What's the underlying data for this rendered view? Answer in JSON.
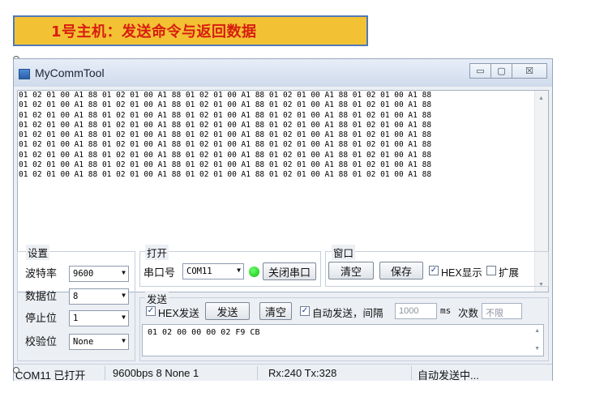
{
  "banner": {
    "text": "1号主机：发送命令与返回数据"
  },
  "window": {
    "title": "MyCommTool",
    "buttons": {
      "minimize": "▭",
      "maximize": "▢",
      "close": "☒"
    }
  },
  "receive": {
    "lines": [
      "01 02 01 00 A1 88 01 02 01 00 A1 88 01 02 01 00 A1 88 01 02 01 00 A1 88 01 02 01 00 A1 88",
      "01 02 01 00 A1 88 01 02 01 00 A1 88 01 02 01 00 A1 88 01 02 01 00 A1 88 01 02 01 00 A1 88",
      "01 02 01 00 A1 88 01 02 01 00 A1 88 01 02 01 00 A1 88 01 02 01 00 A1 88 01 02 01 00 A1 88",
      "01 02 01 00 A1 88 01 02 01 00 A1 88 01 02 01 00 A1 88 01 02 01 00 A1 88 01 02 01 00 A1 88",
      "01 02 01 00 A1 88 01 02 01 00 A1 88 01 02 01 00 A1 88 01 02 01 00 A1 88 01 02 01 00 A1 88",
      "01 02 01 00 A1 88 01 02 01 00 A1 88 01 02 01 00 A1 88 01 02 01 00 A1 88 01 02 01 00 A1 88",
      "01 02 01 00 A1 88 01 02 01 00 A1 88 01 02 01 00 A1 88 01 02 01 00 A1 88 01 02 01 00 A1 88",
      "01 02 01 00 A1 88 01 02 01 00 A1 88 01 02 01 00 A1 88 01 02 01 00 A1 88 01 02 01 00 A1 88",
      "01 02 01 00 A1 88 01 02 01 00 A1 88 01 02 01 00 A1 88 01 02 01 00 A1 88 01 02 01 00 A1 88"
    ]
  },
  "settings": {
    "group_label": "设置",
    "baud": {
      "label": "波特率",
      "value": "9600"
    },
    "databits": {
      "label": "数据位",
      "value": "8"
    },
    "stopbits": {
      "label": "停止位",
      "value": "1"
    },
    "parity": {
      "label": "校验位",
      "value": "None"
    }
  },
  "open": {
    "group_label": "打开",
    "port_label": "串口号",
    "port_value": "COM11",
    "status_color": "#10c010",
    "close_port_button": "关闭串口"
  },
  "view": {
    "group_label": "窗口",
    "clear_button": "清空",
    "save_button": "保存",
    "hex_display_label": "HEX显示",
    "expand_label": "扩展"
  },
  "send": {
    "group_label": "发送",
    "hex_send_label": "HEX发送",
    "send_button": "发送",
    "clear_button": "清空",
    "auto_send_label": "自动发送，间隔",
    "interval_value": "1000",
    "ms_label": "ms",
    "count_label": "次数",
    "count_value": "不限",
    "input_text": "01 02 00 00 00 02 F9 CB"
  },
  "statusbar": {
    "port_status": "COM11 已打开",
    "config": "9600bps  8  None  1",
    "counters": "Rx:240  Tx:328",
    "auto_status": "自动发送中..."
  },
  "icons": {
    "dropdown": "▼",
    "check": "✓",
    "scroll_up": "▲",
    "scroll_down": "▼"
  }
}
